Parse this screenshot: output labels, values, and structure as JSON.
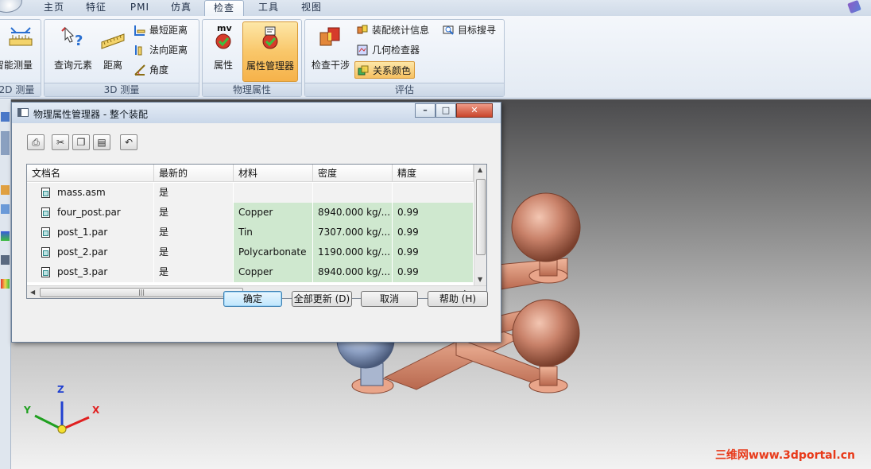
{
  "ribbon": {
    "tabs": [
      {
        "label": "主页",
        "active": false
      },
      {
        "label": "特征",
        "active": false
      },
      {
        "label": "PMI",
        "active": false
      },
      {
        "label": "仿真",
        "active": false
      },
      {
        "label": "检查",
        "active": true
      },
      {
        "label": "工具",
        "active": false
      },
      {
        "label": "视图",
        "active": false
      }
    ],
    "groups": {
      "measure2d": {
        "title": "2D 测量",
        "smart_measure": "智能测量"
      },
      "measure3d": {
        "title": "3D 测量",
        "inquire_element": "查询元素",
        "distance": "距离",
        "min_distance": "最短距离",
        "normal_distance": "法向距离",
        "angle": "角度"
      },
      "physical": {
        "title": "物理属性",
        "properties": "属性",
        "properties_icon_text": "mv",
        "properties_manager": "属性管理器"
      },
      "evaluate": {
        "title": "评估",
        "check_interference": "检查干涉",
        "assembly_stats": "装配统计信息",
        "target_seeker": "目标搜寻",
        "geometry_inspector": "几何检查器",
        "relationship_color": "关系颜色"
      }
    }
  },
  "dialog": {
    "title": "物理属性管理器 - 整个装配",
    "columns": [
      "文档名",
      "最新的",
      "材料",
      "密度",
      "精度"
    ],
    "rows": [
      {
        "name": "mass.asm",
        "up_to_date": "是",
        "material": "",
        "density": "",
        "accuracy": ""
      },
      {
        "name": "four_post.par",
        "up_to_date": "是",
        "material": "Copper",
        "density": "8940.000 kg/...",
        "accuracy": "0.99"
      },
      {
        "name": "post_1.par",
        "up_to_date": "是",
        "material": "Tin",
        "density": "7307.000 kg/...",
        "accuracy": "0.99"
      },
      {
        "name": "post_2.par",
        "up_to_date": "是",
        "material": "Polycarbonate",
        "density": "1190.000 kg/...",
        "accuracy": "0.99"
      },
      {
        "name": "post_3.par",
        "up_to_date": "是",
        "material": "Copper",
        "density": "8940.000 kg/...",
        "accuracy": "0.99"
      }
    ],
    "buttons": {
      "ok": "确定",
      "update_all": "全部更新 (D)",
      "cancel": "取消",
      "help": "帮助 (H)"
    }
  },
  "triad": {
    "x": "X",
    "y": "Y",
    "z": "Z"
  },
  "watermark": "三维网www.3dportal.cn",
  "colors": {
    "active_tab_fill": "#f6b24a",
    "copper": "#c9826a",
    "material_cell": "#cfe8cf",
    "axis_x": "#e02020",
    "axis_y": "#20a020",
    "axis_z": "#2040d0"
  }
}
